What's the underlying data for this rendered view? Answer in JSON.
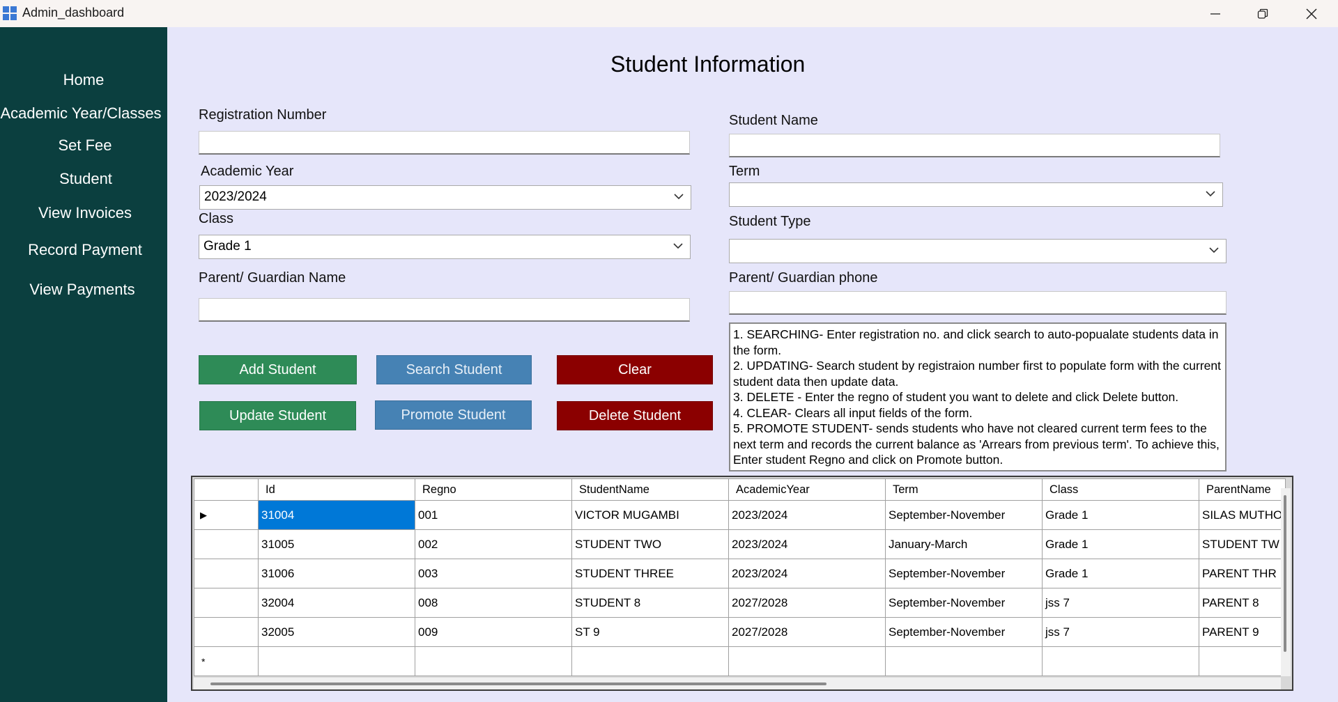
{
  "window": {
    "title": "Admin_dashboard",
    "min": "—",
    "max": "❐",
    "close": "✕"
  },
  "sidebar": {
    "items": [
      {
        "label": "Home"
      },
      {
        "label": "Academic Year/Classes"
      },
      {
        "label": "Set Fee"
      },
      {
        "label": "Student"
      },
      {
        "label": "View Invoices"
      },
      {
        "label": "Record Payment"
      },
      {
        "label": "View Payments"
      }
    ]
  },
  "page": {
    "title": "Student Information"
  },
  "form": {
    "registration_number": {
      "label": "Registration Number",
      "value": ""
    },
    "student_name": {
      "label": "Student Name",
      "value": ""
    },
    "academic_year": {
      "label": "Academic Year",
      "value": "2023/2024"
    },
    "term": {
      "label": "Term",
      "value": ""
    },
    "class": {
      "label": "Class",
      "value": "Grade 1"
    },
    "student_type": {
      "label": "Student Type",
      "value": ""
    },
    "parent_name": {
      "label": "Parent/ Guardian Name",
      "value": ""
    },
    "parent_phone": {
      "label": "Parent/ Guardian phone",
      "value": ""
    }
  },
  "buttons": {
    "add": "Add Student",
    "search": "Search Student",
    "clear": "Clear",
    "update": "Update Student",
    "promote": "Promote Student",
    "delete": "Delete Student"
  },
  "instructions": [
    "1. SEARCHING- Enter registration no. and click search to auto-popualate students data in the form.",
    "2. UPDATING- Search student by registraion number first to populate form with the current student data then update data.",
    "3. DELETE - Enter the regno of student you want to delete and click Delete button.",
    "4. CLEAR- Clears all input fields of the form.",
    "5. PROMOTE STUDENT- sends students who have not cleared current term fees to the next term and records the current balance as 'Arrears from previous term'. To achieve this, Enter student Regno and click on Promote button."
  ],
  "table": {
    "columns": [
      "Id",
      "Regno",
      "StudentName",
      "AcademicYear",
      "Term",
      "Class",
      "ParentName"
    ],
    "rows": [
      [
        "31004",
        "001",
        "VICTOR MUGAMBI",
        "2023/2024",
        "September-November",
        "Grade 1",
        "SILAS MUTHO"
      ],
      [
        "31005",
        "002",
        "STUDENT TWO",
        "2023/2024",
        "January-March",
        "Grade 1",
        "STUDENT TW"
      ],
      [
        "31006",
        "003",
        "STUDENT THREE",
        "2023/2024",
        "September-November",
        "Grade 1",
        "PARENT THR"
      ],
      [
        "32004",
        "008",
        "STUDENT 8",
        "2027/2028",
        "September-November",
        "jss 7",
        "PARENT 8"
      ],
      [
        "32005",
        "009",
        "ST 9",
        "2027/2028",
        "September-November",
        "jss 7",
        "PARENT 9"
      ]
    ],
    "current_row_marker": "▶",
    "new_row_marker": "*"
  },
  "colors": {
    "sidebar": "#0b3f3f",
    "background": "#e6e6fa",
    "green_button": "#2e8b57",
    "blue_button": "#4682b4",
    "red_button": "#8b0000",
    "selection": "#0078d7"
  }
}
